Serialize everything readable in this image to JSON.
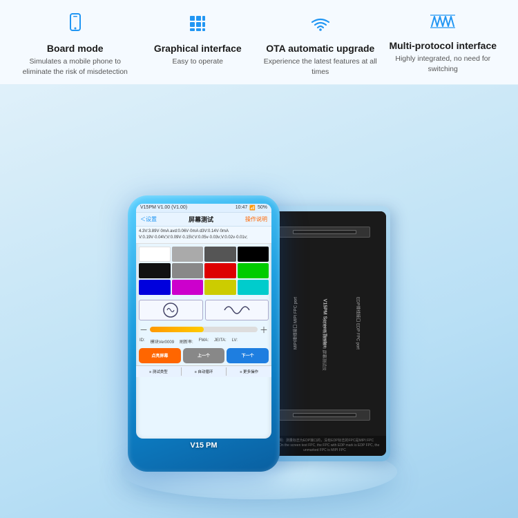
{
  "features": [
    {
      "id": "board-mode",
      "icon": "📱",
      "title": "Board mode",
      "desc": "Simulates a mobile phone to eliminate the risk of misdetection"
    },
    {
      "id": "graphical-interface",
      "icon": "⊞",
      "title": "Graphical interface",
      "desc": "Easy to operate"
    },
    {
      "id": "ota-upgrade",
      "icon": "📶",
      "title": "OTA automatic upgrade",
      "desc": "Experience the latest features at all times"
    },
    {
      "id": "multi-protocol",
      "icon": "〜",
      "title": "Multi-protocol interface",
      "desc": "Highly integrated, no need for switching"
    }
  ],
  "device": {
    "screen": {
      "status_bar": {
        "model": "V15PM V1.00 (V1.00)",
        "time": "10:47",
        "battery": "50%"
      },
      "nav": {
        "back": "＜设置",
        "title": "屏幕测试",
        "action": "操作说明"
      },
      "voltage": "4.3V:3.89V·0mA  avd:0.06V·0mA  d3V:0.14V·0mA\nV:0.19V·0.04V;V:0.09V·0.15V;V:0.05v·0.03v;V:0.02v·0.01v;",
      "colors": [
        "#ffffff",
        "#aaaaaa",
        "#555555",
        "#000000",
        "#000000",
        "#888888",
        "#cc0000",
        "#00cc00",
        "#0000cc",
        "#cc00cc",
        "#cccc00",
        "#00cccc"
      ],
      "info_id": "ID:",
      "info_model": "模块Ver0009",
      "info_refresh": "刷新率:",
      "info_fma": "FMA:",
      "info_jeita": "JEITA:",
      "info_lv": "LV:",
      "btn1": "点亮屏幕",
      "btn2": "上一个",
      "btn3": "下一个",
      "menu1": "≡ 测试类型",
      "menu2": "≡ 自动循环",
      "menu3": "≡ 更多操作"
    },
    "label": "V15 PM",
    "back_board": {
      "brand": "V15PM Screen Tester",
      "sub": "JCID·精诚创新 ‖ 屏幕测试仪",
      "label_top": "EDP排线接口 EDP FPC port",
      "label_bottom": "MIPI排线接口 MIPI FPC port",
      "note": "说明：测量标志为EDP接口的，没有EDP标志的FPC是MIPI FPC"
    }
  }
}
